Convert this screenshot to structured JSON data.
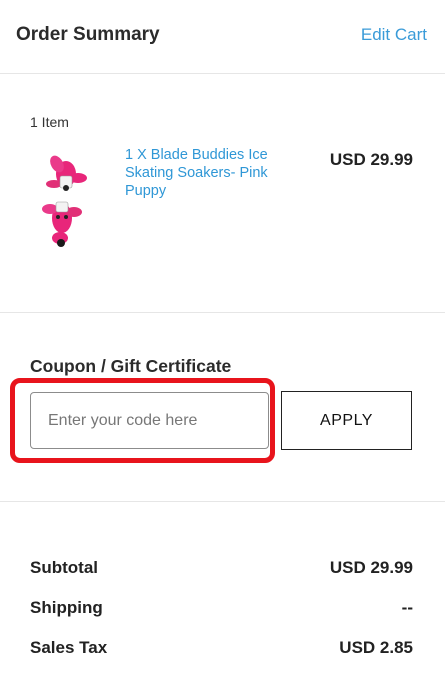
{
  "header": {
    "title": "Order Summary",
    "edit_cart": "Edit Cart"
  },
  "cart": {
    "item_count": "1 Item",
    "items": [
      {
        "name": "1 X Blade Buddies Ice Skating Soakers- Pink Puppy",
        "price": "USD 29.99",
        "image_icon": "pink-puppy-soaker-image"
      }
    ]
  },
  "coupon": {
    "label": "Coupon / Gift Certificate",
    "placeholder": "Enter your code here",
    "value": "",
    "apply_label": "APPLY",
    "highlight_color": "#e8141c"
  },
  "totals": {
    "subtotal_label": "Subtotal",
    "subtotal_value": "USD 29.99",
    "shipping_label": "Shipping",
    "shipping_value": "--",
    "tax_label": "Sales Tax",
    "tax_value": "USD 2.85"
  },
  "colors": {
    "link": "#3a9bd8",
    "accent_highlight": "#e8141c"
  }
}
